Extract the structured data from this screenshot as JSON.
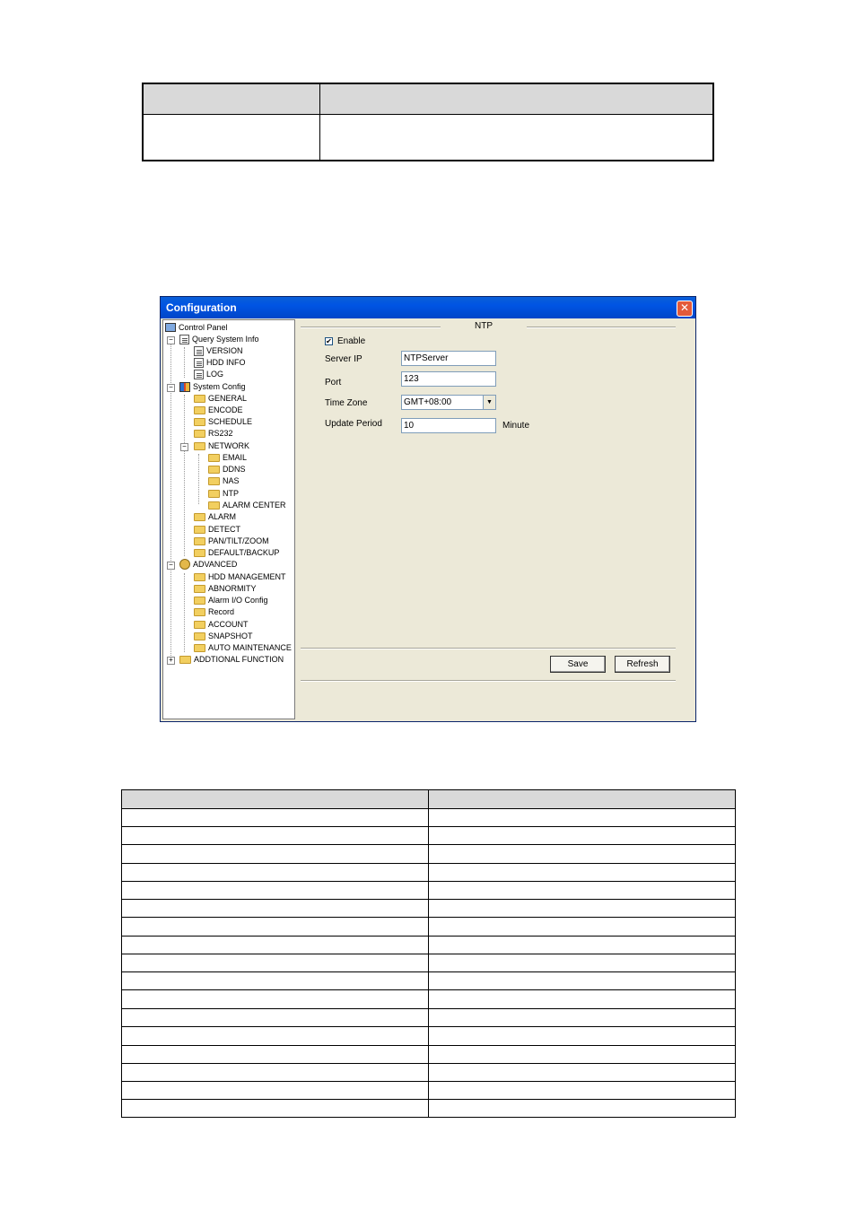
{
  "dialog": {
    "title": "Configuration",
    "close_glyph": "✕"
  },
  "tree": {
    "items": [
      {
        "label": "Control Panel",
        "icon": "monitor-icon"
      },
      {
        "label": "Query System Info",
        "icon": "doc-icon"
      },
      {
        "label": "VERSION",
        "icon": "doc-icon"
      },
      {
        "label": "HDD INFO",
        "icon": "doc-icon"
      },
      {
        "label": "LOG",
        "icon": "doc-icon"
      },
      {
        "label": "System Config",
        "icon": "tools-icon"
      },
      {
        "label": "GENERAL",
        "icon": "folder-icon"
      },
      {
        "label": "ENCODE",
        "icon": "folder-icon"
      },
      {
        "label": "SCHEDULE",
        "icon": "folder-icon"
      },
      {
        "label": "RS232",
        "icon": "folder-icon"
      },
      {
        "label": "NETWORK",
        "icon": "folder-icon"
      },
      {
        "label": "EMAIL",
        "icon": "folder-icon"
      },
      {
        "label": "DDNS",
        "icon": "folder-icon"
      },
      {
        "label": "NAS",
        "icon": "folder-icon"
      },
      {
        "label": "NTP",
        "icon": "folder-icon"
      },
      {
        "label": "ALARM CENTER",
        "icon": "folder-icon"
      },
      {
        "label": "ALARM",
        "icon": "folder-icon"
      },
      {
        "label": "DETECT",
        "icon": "folder-icon"
      },
      {
        "label": "PAN/TILT/ZOOM",
        "icon": "folder-icon"
      },
      {
        "label": "DEFAULT/BACKUP",
        "icon": "folder-icon"
      },
      {
        "label": "ADVANCED",
        "icon": "gear-icon"
      },
      {
        "label": "HDD MANAGEMENT",
        "icon": "folder-icon"
      },
      {
        "label": "ABNORMITY",
        "icon": "folder-icon"
      },
      {
        "label": "Alarm I/O Config",
        "icon": "folder-icon"
      },
      {
        "label": "Record",
        "icon": "folder-icon"
      },
      {
        "label": "ACCOUNT",
        "icon": "folder-icon"
      },
      {
        "label": "SNAPSHOT",
        "icon": "folder-icon"
      },
      {
        "label": "AUTO MAINTENANCE",
        "icon": "folder-icon"
      },
      {
        "label": "ADDTIONAL FUNCTION",
        "icon": "folder-icon"
      }
    ],
    "expander_minus": "−",
    "expander_plus": "+"
  },
  "ntp": {
    "section_title": "NTP",
    "enable_label": "Enable",
    "enable_checked": "✔",
    "server_ip_label": "Server IP",
    "server_ip_value": "NTPServer",
    "port_label": "Port",
    "port_value": "123",
    "time_zone_label": "Time Zone",
    "time_zone_value": "GMT+08:00",
    "dropdown_glyph": "▼",
    "update_period_label": "Update Period",
    "update_period_value": "10",
    "update_period_unit": "Minute",
    "save_label": "Save",
    "refresh_label": "Refresh"
  }
}
